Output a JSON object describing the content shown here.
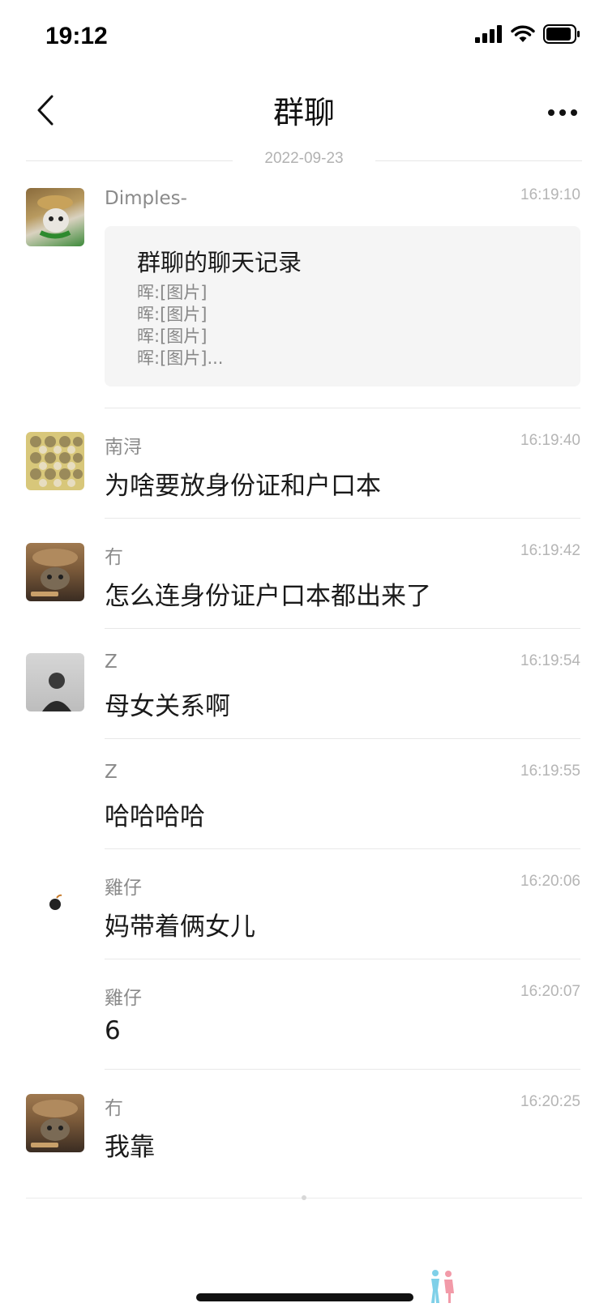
{
  "status_bar": {
    "time": "19:12"
  },
  "nav": {
    "title": "群聊"
  },
  "date_divider": "2022-09-23",
  "record": {
    "sender": "Dimples-",
    "time": "16:19:10",
    "title": "群聊的聊天记录",
    "lines": [
      "晖:[图片]",
      "晖:[图片]",
      "晖:[图片]",
      "晖:[图片]..."
    ]
  },
  "messages": [
    {
      "sender": "南浔",
      "time": "16:19:40",
      "text": "为啥要放身份证和户口本"
    },
    {
      "sender": "冇",
      "time": "16:19:42",
      "text": "怎么连身份证户口本都出来了"
    },
    {
      "sender": "Z",
      "time": "16:19:54",
      "text": "母女关系啊"
    },
    {
      "sender": "Z",
      "time": "16:19:55",
      "text": "哈哈哈哈"
    },
    {
      "sender": "雞仔",
      "time": "16:20:06",
      "text": "妈带着俩女儿"
    },
    {
      "sender": "雞仔",
      "time": "16:20:07",
      "text": "6"
    },
    {
      "sender": "冇",
      "time": "16:20:25",
      "text": "我靠"
    }
  ],
  "icons": {
    "back": "chevron-left-icon",
    "more": "more-dots-icon",
    "signal": "signal-icon",
    "wifi": "wifi-icon",
    "battery": "battery-icon"
  },
  "colors": {
    "card_bg": "#f5f5f5",
    "meta_text": "#b5b5b5",
    "sender_text": "#8a8a8a"
  }
}
